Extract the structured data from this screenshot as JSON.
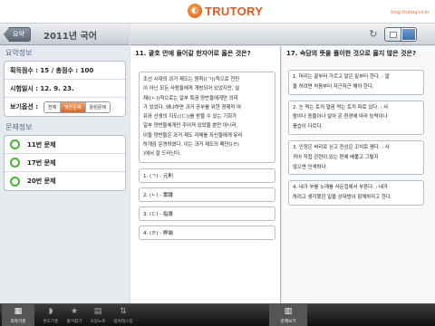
{
  "brand": {
    "logo": "TRUTORY",
    "blog": "blog.trutory.co.kr"
  },
  "nav": {
    "back_label": "요약",
    "title": "2011년 국어"
  },
  "summary": {
    "section_title": "요약정보",
    "score": "획득점수 : 15 / 총점수 : 100",
    "date": "시험일시 : 12. 9. 23.",
    "view_option_label": "보기옵션 :",
    "view_options": [
      "전체",
      "맞은문제",
      "틀린문제"
    ],
    "selected_option": "맞은문제"
  },
  "questions_section": {
    "title": "문제정보",
    "items": [
      {
        "label": "11번 문제"
      },
      {
        "label": "17번 문제"
      },
      {
        "label": "20번 문제"
      }
    ]
  },
  "toolbar": {
    "refresh_icon": "refresh-icon",
    "view_icons": [
      "single-page-icon",
      "double-page-icon"
    ]
  },
  "q11": {
    "title": "11. 괄호 안에 들어갈 한자어로 옳은 것은?",
    "passage": [
      "조선 시대의 과거 제도는 원칙((ㄱ))적으로 천민",
      "이 아닌 모든 사람들에게 개방되어 있었지만, 실",
      "제((ㄴ))적으로는 일부 특권 양반들에게만 의미",
      "가 있었다. 왜냐하면 과거 공부를 위한 경제적 여",
      "유와 선생의 지도((ㄷ))를 받을 수 있는 기회가",
      "일부 양반들에게만 주어져 있었을 뿐만 아니라,",
      "이들 양반들은 과거 제도 자체를 자신들에게 유리",
      "하게끔 운영하였다. 이는 과거 제도의 폐단((ㄹ)",
      ")에서 잘 드러난다."
    ],
    "options": [
      "1. (ㄱ) - 元則",
      "2. (ㄴ) - 實踐",
      "3. (ㄷ) - 指導",
      "4. (ㄹ) - 弊端"
    ]
  },
  "q17": {
    "title": "17. 속담의 뜻을 풀이한 것으로 옳지 않은 것은?",
    "options": [
      [
        "1. 머리는 끝부터 가르고 말은 밑부터 한다. : 말",
        "을 하려면 처음부터 자근자근 해야 한다."
      ],
      [
        "2. 눈 먹는 토끼 얼음 먹는 토끼 따로 있다. : 사",
        "람이나 동물이나 살아 온 환경에 따라 능력이나",
        "풍습이 다르다."
      ],
      [
        "3. 인정은 바리로 싣고 진상은 꼬치로 꿴다. : 사",
        "귀어 직접 관련이 있는 편에 베풀고 그렇지",
        "않으면 인색하다."
      ],
      [
        "4. 내가 부를 노래를 사돈집에서 부른다. : 내가",
        "하려고 생각했던 일을 상대방이 함께하자고 한다."
      ]
    ]
  },
  "tabs": [
    {
      "icon": "calendar-icon",
      "glyph": "▦",
      "label": "과목기준",
      "active": true
    },
    {
      "icon": "tag-icon",
      "glyph": "◗",
      "label": "완도기준",
      "active": false
    },
    {
      "icon": "star-icon",
      "glyph": "★",
      "label": "즐겨찾기",
      "active": false
    },
    {
      "icon": "note-icon",
      "glyph": "▤",
      "label": "오답노트",
      "active": false
    },
    {
      "icon": "sort-icon",
      "glyph": "⇅",
      "label": "범위테스팅",
      "active": false
    },
    {
      "icon": "exam-view-icon",
      "glyph": "▥",
      "label": "문제보기",
      "active": true
    }
  ]
}
